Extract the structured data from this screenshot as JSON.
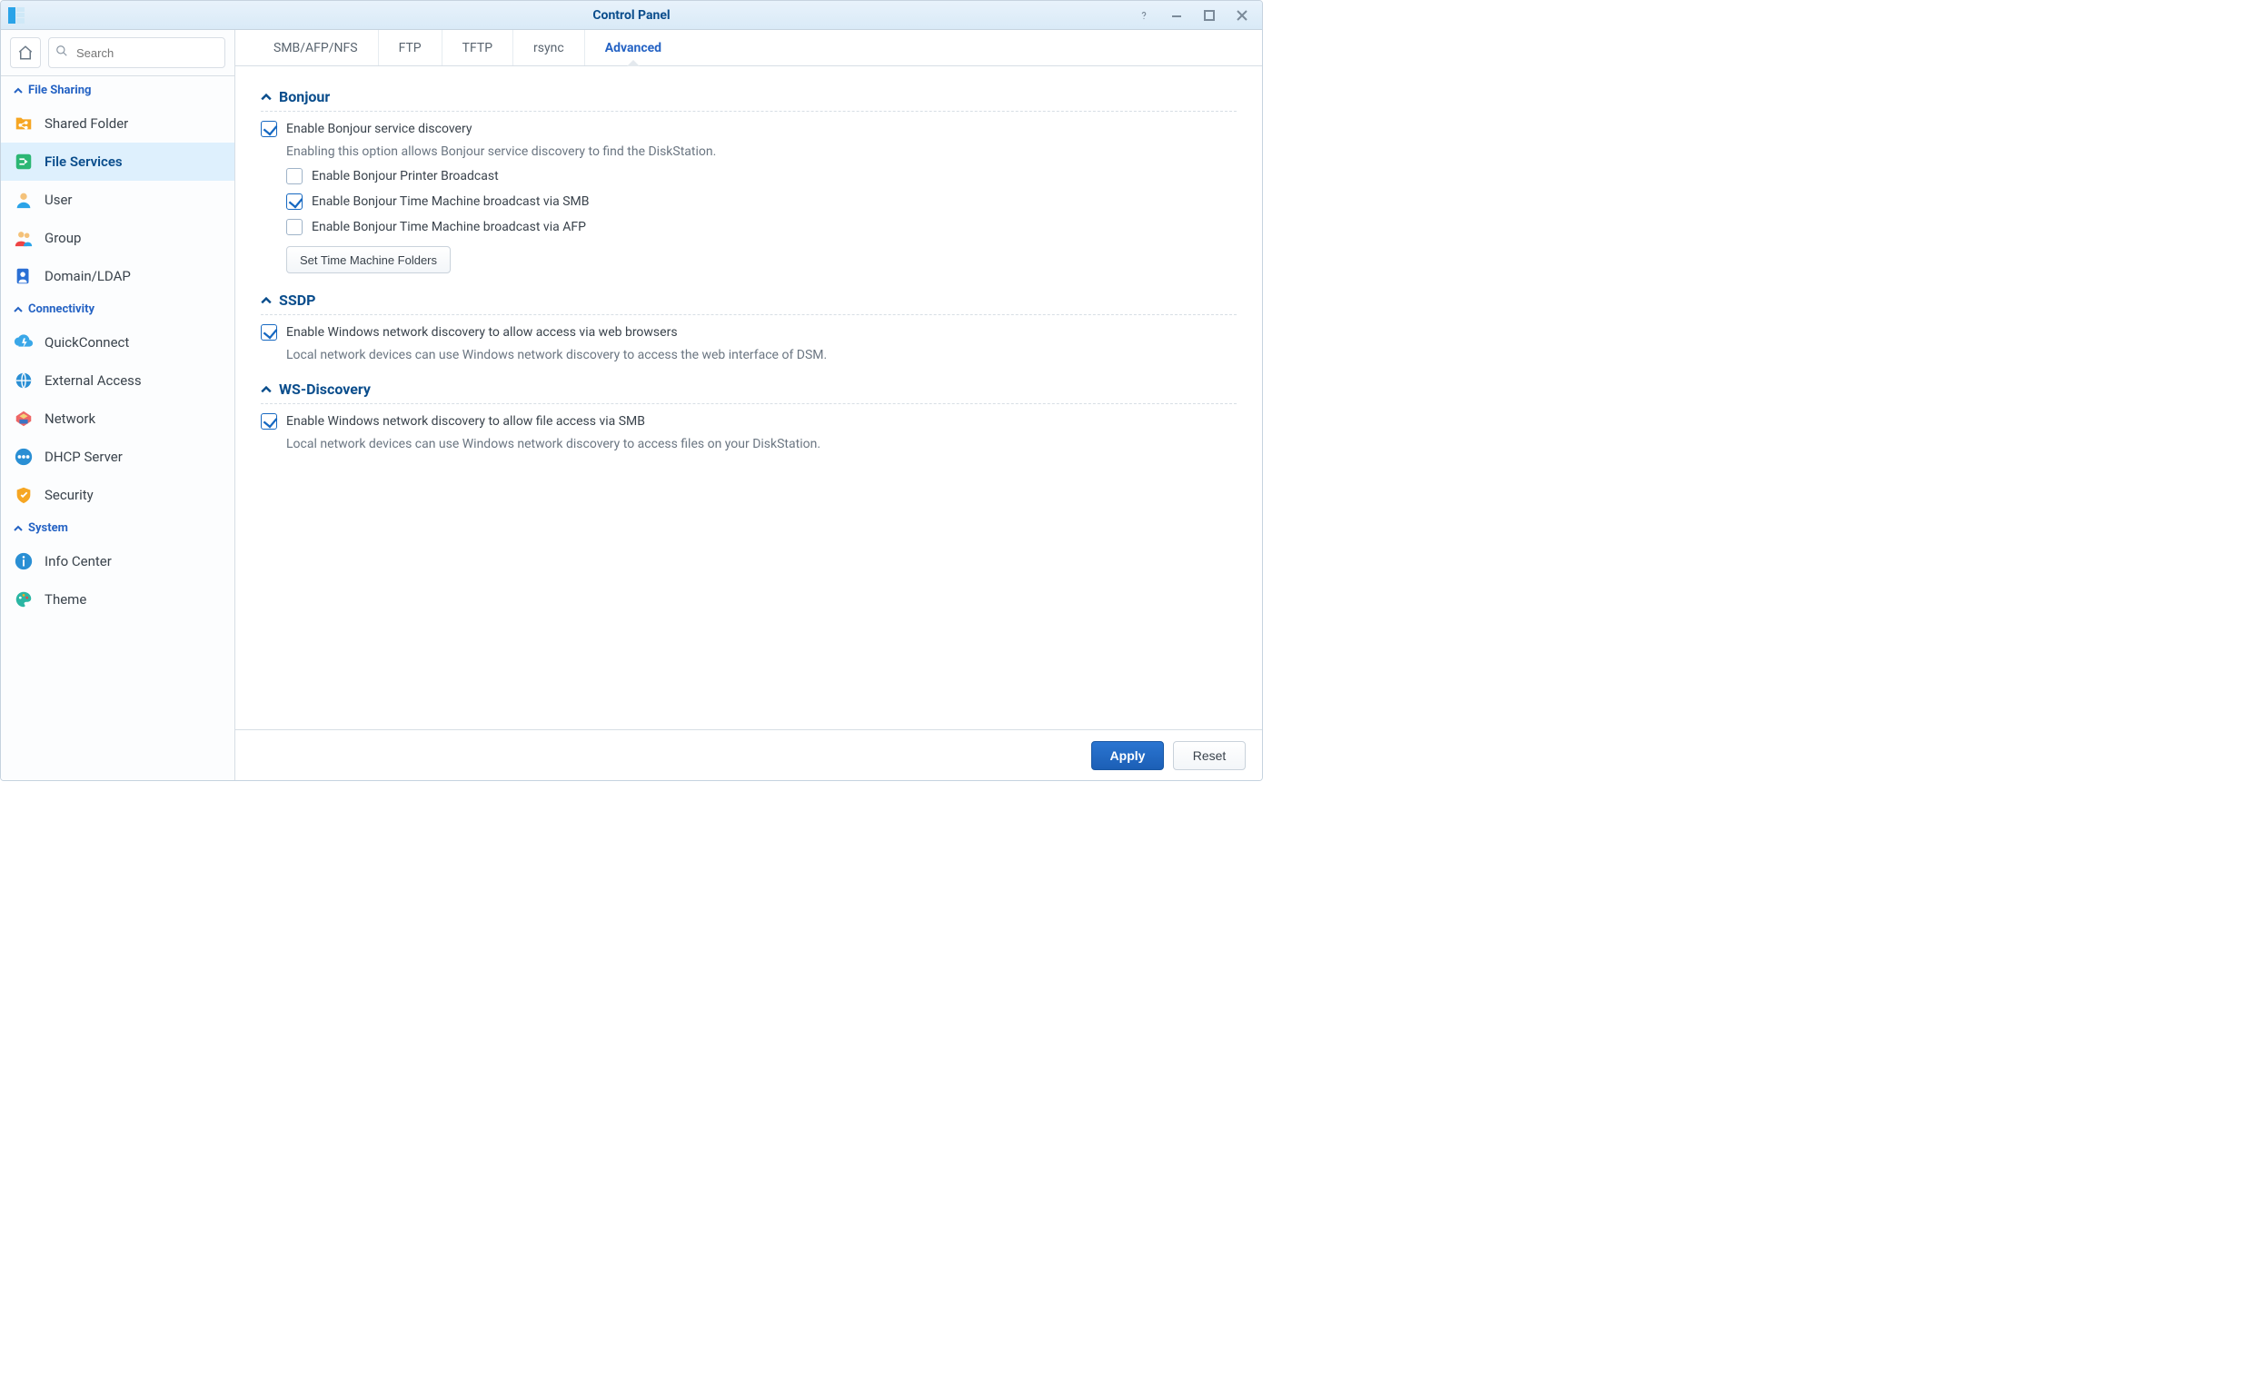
{
  "window": {
    "title": "Control Panel"
  },
  "search": {
    "placeholder": "Search"
  },
  "sidebar": {
    "sections": [
      {
        "label": "File Sharing",
        "items": [
          {
            "id": "shared-folder",
            "label": "Shared Folder"
          },
          {
            "id": "file-services",
            "label": "File Services",
            "selected": true
          },
          {
            "id": "user",
            "label": "User"
          },
          {
            "id": "group",
            "label": "Group"
          },
          {
            "id": "domain-ldap",
            "label": "Domain/LDAP"
          }
        ]
      },
      {
        "label": "Connectivity",
        "items": [
          {
            "id": "quickconnect",
            "label": "QuickConnect"
          },
          {
            "id": "external-access",
            "label": "External Access"
          },
          {
            "id": "network",
            "label": "Network"
          },
          {
            "id": "dhcp-server",
            "label": "DHCP Server"
          },
          {
            "id": "security",
            "label": "Security"
          }
        ]
      },
      {
        "label": "System",
        "items": [
          {
            "id": "info-center",
            "label": "Info Center"
          },
          {
            "id": "theme",
            "label": "Theme"
          }
        ]
      }
    ]
  },
  "tabs": {
    "items": [
      {
        "id": "smb",
        "label": "SMB/AFP/NFS"
      },
      {
        "id": "ftp",
        "label": "FTP"
      },
      {
        "id": "tftp",
        "label": "TFTP"
      },
      {
        "id": "rsync",
        "label": "rsync"
      },
      {
        "id": "advanced",
        "label": "Advanced",
        "active": true
      }
    ]
  },
  "bonjour": {
    "heading": "Bonjour",
    "enable_label": "Enable Bonjour service discovery",
    "enable_checked": true,
    "enable_desc": "Enabling this option allows Bonjour service discovery to find the DiskStation.",
    "printer_label": "Enable Bonjour Printer Broadcast",
    "printer_checked": false,
    "tm_smb_label": "Enable Bonjour Time Machine broadcast via SMB",
    "tm_smb_checked": true,
    "tm_afp_label": "Enable Bonjour Time Machine broadcast via AFP",
    "tm_afp_checked": false,
    "tm_folders_btn": "Set Time Machine Folders"
  },
  "ssdp": {
    "heading": "SSDP",
    "enable_label": "Enable Windows network discovery to allow access via web browsers",
    "enable_checked": true,
    "enable_desc": "Local network devices can use Windows network discovery to access the web interface of DSM."
  },
  "wsd": {
    "heading": "WS-Discovery",
    "enable_label": "Enable Windows network discovery to allow file access via SMB",
    "enable_checked": true,
    "enable_desc": "Local network devices can use Windows network discovery to access files on your DiskStation."
  },
  "footer": {
    "apply": "Apply",
    "reset": "Reset"
  }
}
